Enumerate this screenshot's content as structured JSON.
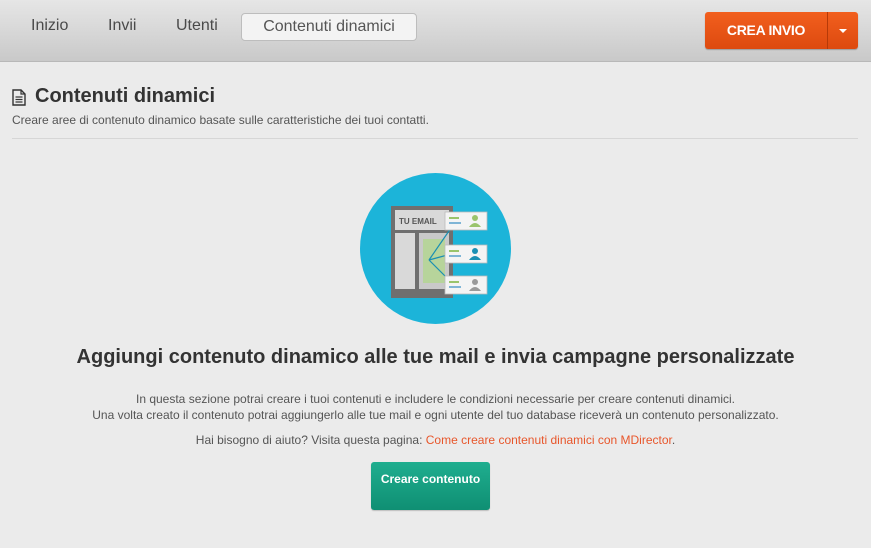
{
  "nav": {
    "tabs": [
      {
        "label": "Inizio"
      },
      {
        "label": "Invii"
      },
      {
        "label": "Utenti"
      },
      {
        "label": "Contenuti dinamici",
        "active": true
      }
    ],
    "crea_invio_label": "CREA INVIO",
    "accent_color": "#e8541a"
  },
  "header": {
    "icon": "document-icon",
    "title": "Contenuti dinamici",
    "subtitle": "Creare aree di contenuto dinamico basate sulle caratteristiche dei tuoi contatti."
  },
  "illustration": {
    "email_label": "TU EMAIL",
    "circle_color": "#1cb4d9"
  },
  "main": {
    "headline": "Aggiungi contenuto dinamico alle tue mail e invia campagne personalizzate",
    "description_line1": "In questa sezione potrai creare i tuoi contenuti e includere le condizioni necessarie per creare contenuti dinamici.",
    "description_line2": "Una volta creato il contenuto potrai aggiungerlo alle tue mail e ogni utente del tuo database riceverà un contenuto personalizzato.",
    "help_prefix": "Hai bisogno di aiuto? Visita questa pagina: ",
    "help_link": "Come creare contenuti dinamici con MDirector",
    "help_suffix": ".",
    "create_button": "Creare contenuto",
    "button_color": "#17a083"
  }
}
